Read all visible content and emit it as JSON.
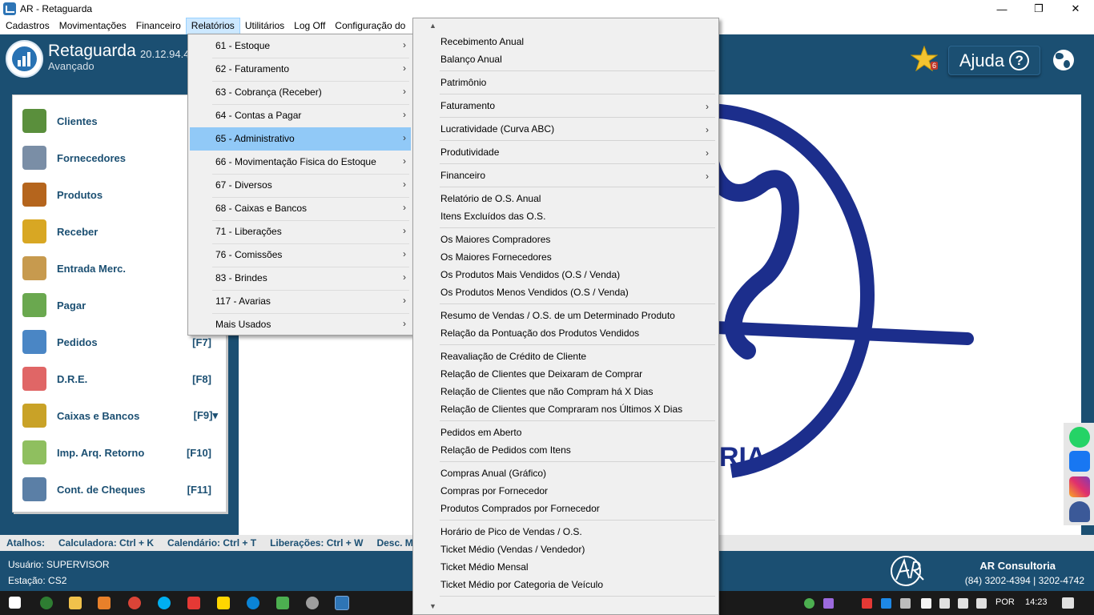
{
  "window": {
    "title": "AR - Retaguarda",
    "minimize": "—",
    "restore": "❐",
    "close": "✕"
  },
  "menubar": [
    "Cadastros",
    "Movimentações",
    "Financeiro",
    "Relatórios",
    "Utilitários",
    "Log Off",
    "Configuração do"
  ],
  "header": {
    "app_name": "Retaguarda",
    "version": "20.12.94.4",
    "edition": "Avançado",
    "star_badge": "6",
    "help_label": "Ajuda",
    "help_glyph": "?"
  },
  "sidebar": {
    "items": [
      {
        "label": "Clientes",
        "key": "",
        "icon": "clients-icon",
        "color": "#5a8f3c"
      },
      {
        "label": "Fornecedores",
        "key": "",
        "icon": "supplier-icon",
        "color": "#7a8ea6"
      },
      {
        "label": "Produtos",
        "key": "",
        "icon": "box-icon",
        "color": "#b5651d"
      },
      {
        "label": "Receber",
        "key": "",
        "icon": "coins-icon",
        "color": "#d8a723"
      },
      {
        "label": "Entrada Merc.",
        "key": "",
        "icon": "boxes-icon",
        "color": "#c79a4e"
      },
      {
        "label": "Pagar",
        "key": "",
        "icon": "money-icon",
        "color": "#6aa84f"
      },
      {
        "label": "Pedidos",
        "key": "[F7]",
        "icon": "clipboard-icon",
        "color": "#4a86c5"
      },
      {
        "label": "D.R.E.",
        "key": "[F8]",
        "icon": "report-icon",
        "color": "#e06666"
      },
      {
        "label": "Caixas e Bancos",
        "key": "[F9]▾",
        "icon": "safe-icon",
        "color": "#c9a227"
      },
      {
        "label": "Imp. Arq. Retorno",
        "key": "[F10]",
        "icon": "import-folder-icon",
        "color": "#8fbf5f"
      },
      {
        "label": "Cont. de Cheques",
        "key": "[F11]",
        "icon": "cheque-icon",
        "color": "#5b7fa6"
      }
    ]
  },
  "reports_menu": {
    "items": [
      {
        "label": "61 - Estoque"
      },
      {
        "label": "62 - Faturamento"
      },
      {
        "label": "63 - Cobrança (Receber)"
      },
      {
        "label": "64 - Contas a Pagar"
      },
      {
        "label": "65 - Administrativo",
        "highlighted": true
      },
      {
        "label": "66 - Movimentação Fisica do Estoque"
      },
      {
        "label": "67 - Diversos"
      },
      {
        "label": "68 - Caixas e Bancos"
      },
      {
        "label": "71 - Liberações"
      },
      {
        "label": "76 - Comissões"
      },
      {
        "label": "83 - Brindes"
      },
      {
        "label": "117 - Avarias"
      },
      {
        "label": "Mais Usados"
      }
    ]
  },
  "admin_menu": {
    "groups": [
      [
        "Recebimento Anual",
        "Balanço Anual"
      ],
      [
        "Patrimônio"
      ],
      [
        "Faturamento"
      ],
      [
        "Lucratividade (Curva ABC)"
      ],
      [
        "Produtividade"
      ],
      [
        "Financeiro"
      ],
      [
        "Relatório de O.S. Anual",
        "Itens Excluídos das O.S."
      ],
      [
        "Os Maiores Compradores",
        "Os Maiores Fornecedores",
        "Os Produtos Mais Vendidos (O.S / Venda)",
        "Os Produtos Menos Vendidos (O.S / Venda)"
      ],
      [
        "Resumo de Vendas / O.S. de um Determinado Produto",
        "Relação da Pontuação dos Produtos Vendidos"
      ],
      [
        "Reavaliação de Crédito de Cliente",
        "Relação de Clientes que Deixaram de Comprar",
        "Relação de Clientes que não Compram há X Dias",
        "Relação de Clientes que Compraram nos Últimos X Dias"
      ],
      [
        "Pedidos em Aberto",
        "Relação de Pedidos com Itens"
      ],
      [
        "Compras Anual (Gráfico)",
        "Compras por Fornecedor",
        "Produtos Comprados por Fornecedor"
      ],
      [
        "Horário de Pico de Vendas / O.S.",
        "Ticket Médio (Vendas / Vendedor)",
        "Ticket Médio Mensal",
        "Ticket Médio por Categoria de Veículo"
      ]
    ],
    "submenus": [
      "Faturamento",
      "Lucratividade (Curva ABC)",
      "Produtividade",
      "Financeiro"
    ]
  },
  "background_text": "RIA",
  "shortcuts": [
    "Atalhos:",
    "Calculadora: Ctrl + K",
    "Calendário: Ctrl + T",
    "Liberações: Ctrl + W",
    "Desc. Mo"
  ],
  "footer": {
    "user": "Usuário: SUPERVISOR",
    "station": "Estação: CS2",
    "company": "AR Consultoria",
    "phones": "(84) 3202-4394 | 3202-4742"
  },
  "taskbar": {
    "lang": "POR",
    "time": "14:23"
  },
  "colors": {
    "brand": "#1b4f72",
    "highlight": "#91c9f7",
    "logo_ring": "#1c2e8c"
  }
}
